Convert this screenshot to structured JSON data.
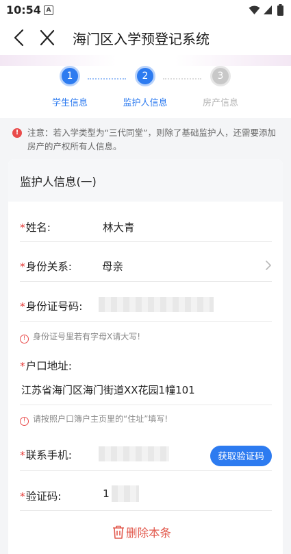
{
  "status_bar": {
    "time": "10:54",
    "notif_letter": "A"
  },
  "nav": {
    "title": "海门区入学预登记系统"
  },
  "steps": [
    {
      "number": "1",
      "label": "学生信息",
      "state": "done"
    },
    {
      "number": "2",
      "label": "监护人信息",
      "state": "active"
    },
    {
      "number": "3",
      "label": "房产信息",
      "state": "pending"
    }
  ],
  "notice": {
    "text": "注意：若入学类型为“三代同堂”，则除了基础监护人，还需要添加房产的产权所有人信息。"
  },
  "card": {
    "title": "监护人信息(一)",
    "required_mark": "*",
    "name": {
      "label": "姓名:",
      "value": "林大青"
    },
    "relation": {
      "label": "身份关系:",
      "value": "母亲"
    },
    "id_number": {
      "label": "身份证号码:",
      "hint": "身份证号里若有字母X请大写!"
    },
    "address": {
      "label": "户口地址:",
      "value": "江苏省海门区海门街道XX花园1幢101",
      "hint": "请按照户口簿户主页里的“住址”填写!"
    },
    "phone": {
      "label": "联系手机:",
      "button": "获取验证码"
    },
    "code": {
      "label": "验证码:",
      "value": "1"
    },
    "delete_label": "删除本条"
  },
  "colors": {
    "accent": "#2d7bf0",
    "required": "#e53935",
    "danger": "#e25a4e"
  }
}
